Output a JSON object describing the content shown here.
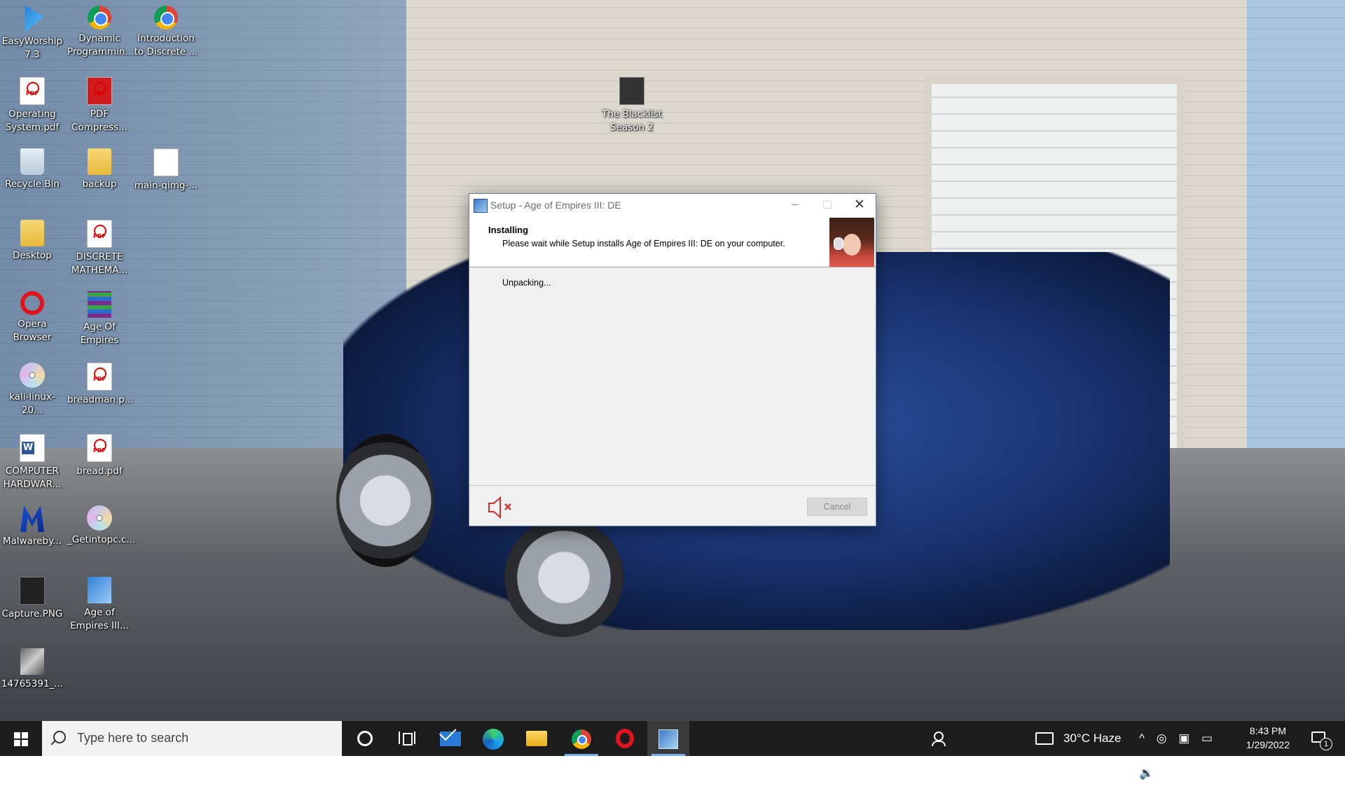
{
  "desktop": {
    "icons": [
      {
        "label": "EasyWorship 7.3",
        "icon": "easyworship-icon"
      },
      {
        "label": "Dynamic Programmin...",
        "icon": "chrome-icon"
      },
      {
        "label": "Introduction to Discrete ...",
        "icon": "chrome-icon"
      },
      {
        "label": "Operating System.pdf",
        "icon": "pdf-icon"
      },
      {
        "label": "PDF Compress...",
        "icon": "pdf-compressor-icon"
      },
      {
        "label": "Recycle Bin",
        "icon": "recycle-bin-icon"
      },
      {
        "label": "backup",
        "icon": "folder-icon"
      },
      {
        "label": "main-qimg-...",
        "icon": "document-icon"
      },
      {
        "label": "Desktop",
        "icon": "folder-icon"
      },
      {
        "label": "DISCRETE MATHEMA...",
        "icon": "pdf-icon"
      },
      {
        "label": "Opera Browser",
        "icon": "opera-icon"
      },
      {
        "label": "Age Of Empires",
        "icon": "winrar-icon"
      },
      {
        "label": "kali-linux-20...",
        "icon": "disc-image-icon"
      },
      {
        "label": "breadman.p...",
        "icon": "pdf-icon"
      },
      {
        "label": "COMPUTER HARDWAR...",
        "icon": "word-icon"
      },
      {
        "label": "bread.pdf",
        "icon": "pdf-icon"
      },
      {
        "label": "Malwareby...",
        "icon": "malwarebytes-icon"
      },
      {
        "label": "_Getintopc.c...",
        "icon": "disc-image-icon"
      },
      {
        "label": "Capture.PNG",
        "icon": "image-icon"
      },
      {
        "label": "Age of Empires III...",
        "icon": "setup-icon"
      },
      {
        "label": "14765391_...",
        "icon": "image-icon"
      },
      {
        "label": "The Blacklist Season 2",
        "icon": "video-folder-icon"
      }
    ]
  },
  "setup_window": {
    "title": "Setup - Age of Empires III: DE",
    "minimize_glyph": "─",
    "maximize_glyph": "☐",
    "close_glyph": "✕",
    "header_title": "Installing",
    "header_subtitle": "Please wait while Setup installs Age of Empires III: DE on your computer.",
    "status_text": "Unpacking...",
    "mute_icon": "speaker-muted-icon",
    "cancel_label": "Cancel"
  },
  "taskbar": {
    "search_placeholder": "Type here to search",
    "apps": [
      "cortana",
      "task-view",
      "mail",
      "edge",
      "file-explorer",
      "chrome",
      "opera",
      "setup"
    ],
    "weather": "30°C  Haze",
    "tray_icons": "^ ◎ ▣ ▭ 🔉",
    "time": "8:43 PM",
    "date": "1/29/2022",
    "notification_count": "1"
  },
  "colors": {
    "taskbar_bg": "#1c1c1c",
    "window_bg": "#f0f0f0",
    "mute_red": "#d0312d"
  }
}
